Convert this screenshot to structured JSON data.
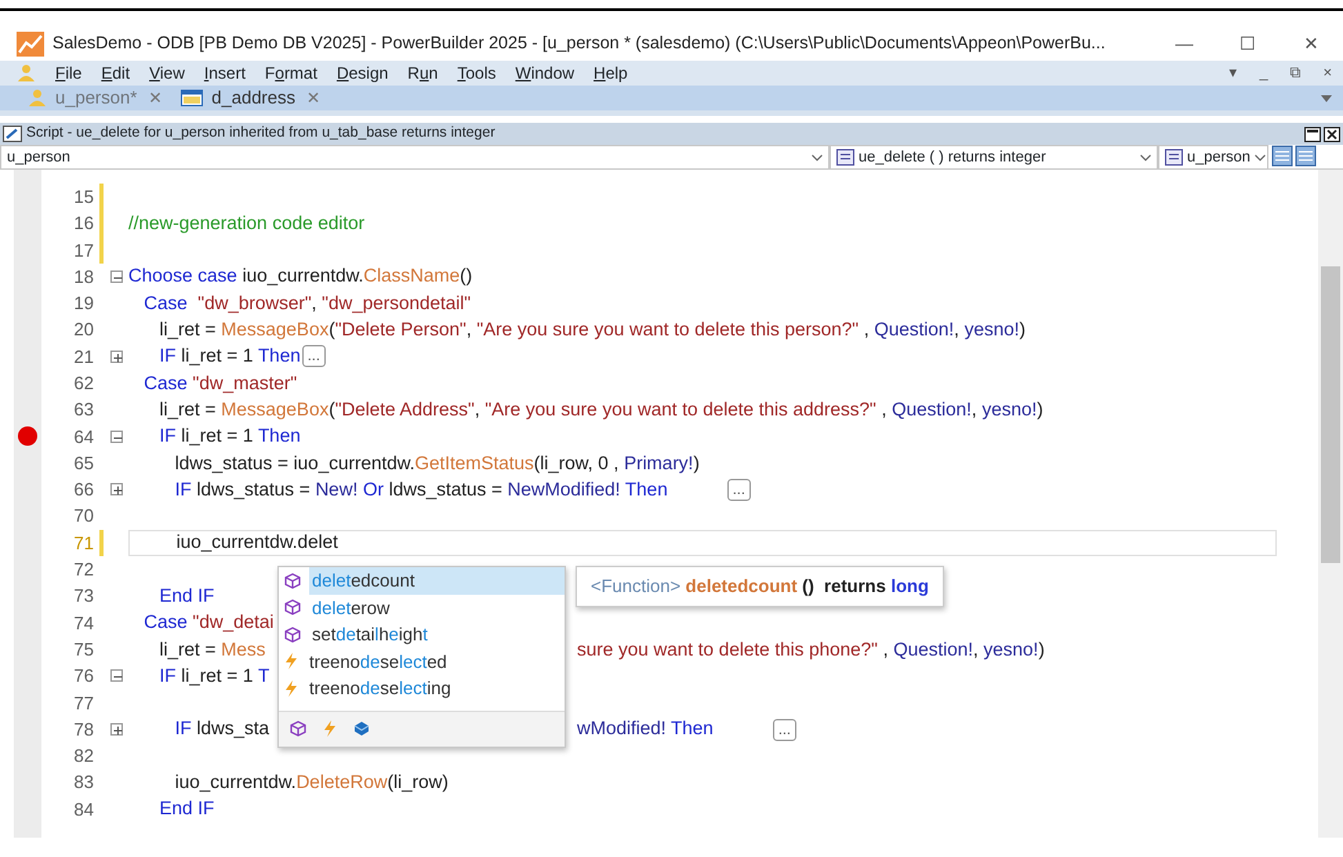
{
  "window": {
    "title": "SalesDemo - ODB [PB Demo DB V2025]  - PowerBuilder 2025 - [u_person * (salesdemo) (C:\\Users\\Public\\Documents\\Appeon\\PowerBu...",
    "controls": [
      "—",
      "☐",
      "✕"
    ]
  },
  "menu": {
    "items": [
      {
        "key": "F",
        "after": "ile"
      },
      {
        "key": "E",
        "after": "dit"
      },
      {
        "key": "V",
        "after": "iew"
      },
      {
        "key": "I",
        "after": "nsert"
      },
      {
        "before": "F",
        "key": "o",
        "after": "rmat"
      },
      {
        "key": "D",
        "after": "esign"
      },
      {
        "before": "R",
        "key": "u",
        "after": "n"
      },
      {
        "key": "T",
        "after": "ools"
      },
      {
        "key": "W",
        "after": "indow"
      },
      {
        "key": "H",
        "after": "elp"
      }
    ],
    "controls": [
      "▾",
      "_",
      "⧉",
      "×"
    ]
  },
  "tabs": [
    {
      "label": "u_person*",
      "kind": "object",
      "selected": true,
      "close": "✕"
    },
    {
      "label": "d_address",
      "kind": "datawindow",
      "selected": false,
      "close": "✕"
    }
  ],
  "script_pane": {
    "title": "Script - ue_delete for u_person inherited from u_tab_base returns integer",
    "selectors": [
      {
        "value": "u_person",
        "kind": "plain"
      },
      {
        "value": "ue_delete ( ) returns integer",
        "kind": "event"
      },
      {
        "value": "u_person",
        "kind": "object"
      }
    ]
  },
  "editor": {
    "lines": [
      {
        "number": "15",
        "changed": true
      },
      {
        "number": "16",
        "changed": true,
        "parts": [
          {
            "kind": "code",
            "tokens": [
              {
                "kind": "comment",
                "text": "//new-generation code editor"
              }
            ]
          }
        ]
      },
      {
        "number": "17",
        "changed": true
      },
      {
        "number": "18",
        "foldable": true,
        "folded": false,
        "parts": [
          {
            "kind": "code",
            "tokens": [
              {
                "kind": "kw",
                "text": "Choose case"
              },
              {
                "kind": "plain",
                "text": " iuo_currentdw."
              },
              {
                "kind": "fn",
                "text": "ClassName"
              },
              {
                "kind": "plain",
                "text": "()"
              }
            ]
          }
        ]
      },
      {
        "number": "19",
        "parts": [
          {
            "kind": "code",
            "tokens": [
              {
                "kind": "kw",
                "text": "   Case"
              },
              {
                "kind": "str",
                "text": "  \"dw_browser\""
              },
              {
                "kind": "plain",
                "text": ", "
              },
              {
                "kind": "str",
                "text": "\"dw_persondetail\""
              }
            ]
          }
        ]
      },
      {
        "number": "20",
        "parts": [
          {
            "kind": "code",
            "tokens": [
              {
                "kind": "plain",
                "text": "      li_ret = "
              },
              {
                "kind": "fn",
                "text": "MessageBox"
              },
              {
                "kind": "plain",
                "text": "("
              },
              {
                "kind": "str",
                "text": "\"Delete Person\""
              },
              {
                "kind": "plain",
                "text": ", "
              },
              {
                "kind": "str",
                "text": "\"Are you sure you want to delete this person?\""
              },
              {
                "kind": "plain",
                "text": " , "
              },
              {
                "kind": "enum",
                "text": "Question!"
              },
              {
                "kind": "plain",
                "text": ", "
              },
              {
                "kind": "enum",
                "text": "yesno!"
              },
              {
                "kind": "plain",
                "text": ")"
              }
            ]
          }
        ]
      },
      {
        "number": "21",
        "foldable": true,
        "folded": true,
        "parts": [
          {
            "kind": "code",
            "tokens": [
              {
                "kind": "kw",
                "text": "      IF"
              },
              {
                "kind": "plain",
                "text": " li_ret = 1 "
              },
              {
                "kind": "kw",
                "text": "Then"
              }
            ]
          },
          {
            "kind": "collapsed",
            "text": "..."
          }
        ]
      },
      {
        "number": "62",
        "parts": [
          {
            "kind": "code",
            "tokens": [
              {
                "kind": "kw",
                "text": "   Case"
              },
              {
                "kind": "str",
                "text": " \"dw_master\""
              }
            ]
          }
        ]
      },
      {
        "number": "63",
        "parts": [
          {
            "kind": "code",
            "tokens": [
              {
                "kind": "plain",
                "text": "      li_ret = "
              },
              {
                "kind": "fn",
                "text": "MessageBox"
              },
              {
                "kind": "plain",
                "text": "("
              },
              {
                "kind": "str",
                "text": "\"Delete Address\""
              },
              {
                "kind": "plain",
                "text": ", "
              },
              {
                "kind": "str",
                "text": "\"Are you sure you want to delete this address?\""
              },
              {
                "kind": "plain",
                "text": " , "
              },
              {
                "kind": "enum",
                "text": "Question!"
              },
              {
                "kind": "plain",
                "text": ", "
              },
              {
                "kind": "enum",
                "text": "yesno!"
              },
              {
                "kind": "plain",
                "text": ")"
              }
            ]
          }
        ]
      },
      {
        "number": "64",
        "breakpoint": true,
        "foldable": true,
        "folded": false,
        "parts": [
          {
            "kind": "code",
            "tokens": [
              {
                "kind": "kw",
                "text": "      IF"
              },
              {
                "kind": "plain",
                "text": " li_ret = 1 "
              },
              {
                "kind": "kw",
                "text": "Then"
              }
            ]
          }
        ]
      },
      {
        "number": "65",
        "parts": [
          {
            "kind": "code",
            "tokens": [
              {
                "kind": "plain",
                "text": "         ldws_status = iuo_currentdw."
              },
              {
                "kind": "fn",
                "text": "GetItemStatus"
              },
              {
                "kind": "plain",
                "text": "(li_row, 0 , "
              },
              {
                "kind": "enum",
                "text": "Primary!"
              },
              {
                "kind": "plain",
                "text": ")"
              }
            ]
          }
        ]
      },
      {
        "number": "66",
        "foldable": true,
        "folded": true,
        "parts": [
          {
            "kind": "code",
            "tokens": [
              {
                "kind": "kw",
                "text": "         IF"
              },
              {
                "kind": "plain",
                "text": " ldws_status = "
              },
              {
                "kind": "enum",
                "text": "New!"
              },
              {
                "kind": "kw",
                "text": " Or"
              },
              {
                "kind": "plain",
                "text": " ldws_status = "
              },
              {
                "kind": "enum",
                "text": "NewModified!"
              },
              {
                "kind": "kw",
                "text": " Then"
              }
            ]
          },
          {
            "kind": "gap"
          },
          {
            "kind": "collapsed",
            "text": "..."
          }
        ]
      },
      {
        "number": "70"
      },
      {
        "number": "71",
        "changed": true,
        "current": true,
        "parts": [
          {
            "kind": "code",
            "tokens": [
              {
                "kind": "plain",
                "text": "         iuo_currentdw.delet"
              }
            ]
          }
        ]
      },
      {
        "number": "72"
      },
      {
        "number": "73",
        "parts": [
          {
            "kind": "code",
            "tokens": [
              {
                "kind": "kw",
                "text": "      End IF"
              }
            ]
          }
        ]
      },
      {
        "number": "74",
        "parts": [
          {
            "kind": "code",
            "tokens": [
              {
                "kind": "kw",
                "text": "   Case"
              },
              {
                "kind": "str",
                "text": " \"dw_detai"
              }
            ]
          }
        ]
      },
      {
        "number": "75",
        "parts": [
          {
            "kind": "code",
            "tokens": [
              {
                "kind": "plain",
                "text": "      li_ret = "
              },
              {
                "kind": "fn",
                "text": "Mess"
              }
            ]
          },
          {
            "kind": "covered"
          },
          {
            "kind": "code",
            "tokens": [
              {
                "kind": "str",
                "text": "sure you want to delete this phone?\""
              },
              {
                "kind": "plain",
                "text": " , "
              },
              {
                "kind": "enum",
                "text": "Question!"
              },
              {
                "kind": "plain",
                "text": ", "
              },
              {
                "kind": "enum",
                "text": "yesno!"
              },
              {
                "kind": "plain",
                "text": ")"
              }
            ]
          }
        ]
      },
      {
        "number": "76",
        "foldable": true,
        "folded": false,
        "parts": [
          {
            "kind": "code",
            "tokens": [
              {
                "kind": "kw",
                "text": "      IF"
              },
              {
                "kind": "plain",
                "text": " li_ret = 1 "
              },
              {
                "kind": "kw",
                "text": "T"
              }
            ]
          }
        ]
      },
      {
        "number": "77"
      },
      {
        "number": "78",
        "foldable": true,
        "folded": true,
        "parts": [
          {
            "kind": "code",
            "tokens": [
              {
                "kind": "kw",
                "text": "         IF"
              },
              {
                "kind": "plain",
                "text": " ldws_sta"
              }
            ]
          },
          {
            "kind": "covered"
          },
          {
            "kind": "code",
            "tokens": [
              {
                "kind": "enum",
                "text": "wModified!"
              },
              {
                "kind": "kw",
                "text": " Then"
              }
            ]
          },
          {
            "kind": "gap"
          },
          {
            "kind": "collapsed",
            "text": "..."
          }
        ]
      },
      {
        "number": "82"
      },
      {
        "number": "83",
        "parts": [
          {
            "kind": "code",
            "tokens": [
              {
                "kind": "plain",
                "text": "         iuo_currentdw."
              },
              {
                "kind": "fn",
                "text": "DeleteRow"
              },
              {
                "kind": "plain",
                "text": "(li_row)"
              }
            ]
          }
        ]
      },
      {
        "number": "84",
        "parts": [
          {
            "kind": "code",
            "tokens": [
              {
                "kind": "kw",
                "text": "      End IF"
              }
            ]
          }
        ]
      }
    ]
  },
  "autocomplete": {
    "items": [
      {
        "kind": "function",
        "selected": true,
        "segments": [
          {
            "text": "delet",
            "match": true
          },
          {
            "text": "edcount",
            "match": false
          }
        ]
      },
      {
        "kind": "function",
        "selected": false,
        "segments": [
          {
            "text": "delet",
            "match": true
          },
          {
            "text": "erow",
            "match": false
          }
        ]
      },
      {
        "kind": "function",
        "selected": false,
        "segments": [
          {
            "text": "set",
            "match": false
          },
          {
            "text": "de",
            "match": true
          },
          {
            "text": "tai",
            "match": false
          },
          {
            "text": "l",
            "match": true
          },
          {
            "text": "h",
            "match": false
          },
          {
            "text": "e",
            "match": true
          },
          {
            "text": "igh",
            "match": false
          },
          {
            "text": "t",
            "match": true
          }
        ]
      },
      {
        "kind": "event",
        "selected": false,
        "segments": [
          {
            "text": "treeno",
            "match": false
          },
          {
            "text": "de",
            "match": true
          },
          {
            "text": "se",
            "match": false
          },
          {
            "text": "lec",
            "match": true
          },
          {
            "text": "t",
            "match": true
          },
          {
            "text": "ed",
            "match": false
          }
        ]
      },
      {
        "kind": "event",
        "selected": false,
        "segments": [
          {
            "text": "treeno",
            "match": false
          },
          {
            "text": "de",
            "match": true
          },
          {
            "text": "se",
            "match": false
          },
          {
            "text": "lec",
            "match": true
          },
          {
            "text": "t",
            "match": true
          },
          {
            "text": "ing",
            "match": false
          }
        ]
      }
    ],
    "filters": [
      {
        "kind": "function"
      },
      {
        "kind": "event"
      },
      {
        "kind": "object"
      }
    ]
  },
  "tooltip": {
    "tokens": [
      {
        "kind": "tag",
        "text": "<Function>"
      },
      {
        "kind": "name",
        "text": " deletedcount"
      },
      {
        "kind": "bold",
        "text": " ()  returns"
      },
      {
        "kind": "type",
        "text": " long"
      }
    ]
  }
}
